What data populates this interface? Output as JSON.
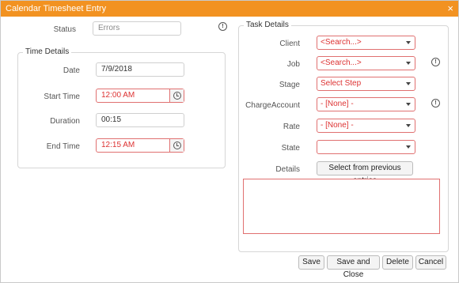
{
  "window": {
    "title": "Calendar Timesheet Entry",
    "close_glyph": "×"
  },
  "status": {
    "label": "Status",
    "value": "Errors"
  },
  "time_details": {
    "legend": "Time Details",
    "date_label": "Date",
    "date_value": "7/9/2018",
    "start_label": "Start Time",
    "start_value": "12:00 AM",
    "duration_label": "Duration",
    "duration_value": "00:15",
    "end_label": "End Time",
    "end_value": "12:15 AM"
  },
  "task_details": {
    "legend": "Task Details",
    "client_label": "Client",
    "client_value": "<Search...>",
    "job_label": "Job",
    "job_value": "<Search...>",
    "stage_label": "Stage",
    "stage_value": "Select Step",
    "charge_label": "ChargeAccount",
    "charge_value": "- [None] -",
    "rate_label": "Rate",
    "rate_value": "- [None] -",
    "state_label": "State",
    "state_value": "",
    "details_label": "Details",
    "details_button": "Select from previous entries",
    "details_text": ""
  },
  "footer": {
    "save": "Save",
    "save_close": "Save and Close",
    "delete": "Delete",
    "cancel": "Cancel"
  },
  "info_glyph": "!",
  "colors": {
    "titlebar": "#f29221",
    "error_border": "#e07070",
    "error_text": "#dd3333"
  }
}
